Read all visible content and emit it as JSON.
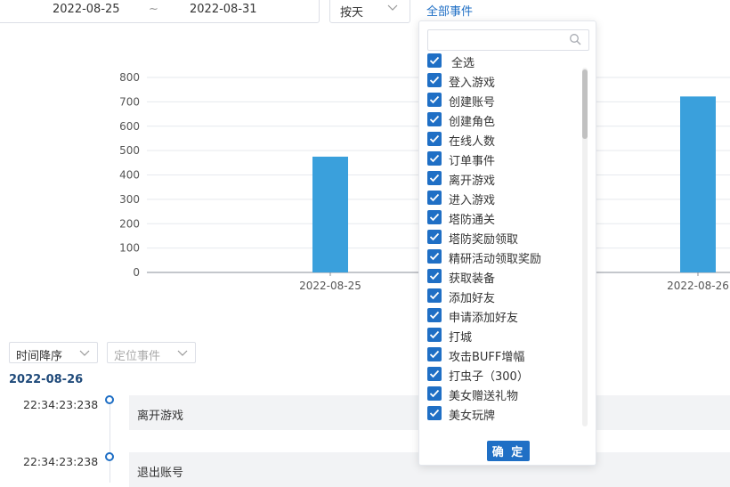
{
  "filters": {
    "date_start": "2022-08-25",
    "date_separator": "~",
    "date_end": "2022-08-31",
    "granularity": "按天",
    "event_trigger": "全部事件"
  },
  "chart_data": {
    "type": "bar",
    "categories": [
      "2022-08-25",
      "2022-08-26"
    ],
    "values": [
      475,
      722
    ],
    "ylim": [
      0,
      800
    ],
    "yticks": [
      "0",
      "100",
      "200",
      "300",
      "400",
      "500",
      "600",
      "700",
      "800"
    ],
    "grid": true,
    "bar_color": "#3aa0dc"
  },
  "event_dropdown": {
    "search_placeholder": "",
    "select_all": "全选",
    "items": [
      "登入游戏",
      "创建账号",
      "创建角色",
      "在线人数",
      "订单事件",
      "离开游戏",
      "进入游戏",
      "塔防通关",
      "塔防奖励领取",
      "精研活动领取奖励",
      "获取装备",
      "添加好友",
      "申请添加好友",
      "打城",
      "攻击BUFF增幅",
      "打虫子（300）",
      "美女赠送礼物",
      "美女玩牌"
    ],
    "confirm_label": "确 定"
  },
  "timeline": {
    "sort_select": "时间降序",
    "locate_select": "定位事件",
    "day": "2022-08-26",
    "entries": [
      {
        "time": "22:34:23:238",
        "event": "离开游戏"
      },
      {
        "time": "22:34:23:238",
        "event": "退出账号"
      }
    ]
  },
  "colors": {
    "accent": "#1f6fc5",
    "bar": "#3aa0dc"
  }
}
